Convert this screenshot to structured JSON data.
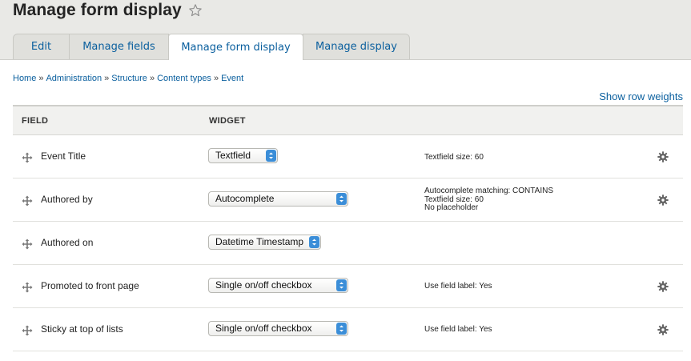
{
  "page": {
    "title": "Manage form display"
  },
  "tabs": [
    {
      "label": "Edit"
    },
    {
      "label": "Manage fields"
    },
    {
      "label": "Manage form display",
      "active": true
    },
    {
      "label": "Manage display"
    }
  ],
  "breadcrumb": [
    "Home",
    "Administration",
    "Structure",
    "Content types",
    "Event"
  ],
  "breadcrumb_separator": "»",
  "row_weights_link": "Show row weights",
  "table": {
    "headers": {
      "field": "FIELD",
      "widget": "WIDGET"
    },
    "rows": [
      {
        "label": "Event Title",
        "widget": "Textfield",
        "summary": [
          "Textfield size: 60"
        ],
        "has_settings": true
      },
      {
        "label": "Authored by",
        "widget": "Autocomplete",
        "summary": [
          "Autocomplete matching: CONTAINS",
          "Textfield size: 60",
          "No placeholder"
        ],
        "has_settings": true
      },
      {
        "label": "Authored on",
        "widget": "Datetime Timestamp",
        "summary": [],
        "has_settings": false
      },
      {
        "label": "Promoted to front page",
        "widget": "Single on/off checkbox",
        "summary": [
          "Use field label: Yes"
        ],
        "has_settings": true
      },
      {
        "label": "Sticky at top of lists",
        "widget": "Single on/off checkbox",
        "summary": [
          "Use field label: Yes"
        ],
        "has_settings": true
      }
    ]
  },
  "icons": {
    "favorite": "star-icon",
    "drag": "drag-handle-icon",
    "settings": "gear-icon",
    "select": "select-arrows-icon"
  },
  "colors": {
    "link": "#0a5f9e",
    "header_bg": "#e9e9e6",
    "select_arrow": "#3b8ed8"
  }
}
